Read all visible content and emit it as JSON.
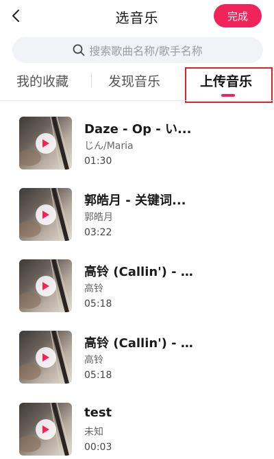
{
  "header": {
    "title": "选音乐",
    "done_label": "完成",
    "accent_color": "#f0245b"
  },
  "search": {
    "placeholder": "搜索歌曲名称/歌手名称"
  },
  "tabs": [
    {
      "label": "我的收藏",
      "active": false
    },
    {
      "label": "发现音乐",
      "active": false
    },
    {
      "label": "上传音乐",
      "active": true
    }
  ],
  "songs": [
    {
      "title": "Daze - Op - い...",
      "artist": "じん/Maria",
      "duration": "01:30"
    },
    {
      "title": "郭皓月 - 关键词...",
      "artist": "郭皓月",
      "duration": "03:22"
    },
    {
      "title": "高铃 (Callin') - ...",
      "artist": "高铃",
      "duration": "05:18"
    },
    {
      "title": "高铃 (Callin') - ...",
      "artist": "高铃",
      "duration": "05:18"
    },
    {
      "title": "test",
      "artist": "未知",
      "duration": "00:03"
    }
  ]
}
